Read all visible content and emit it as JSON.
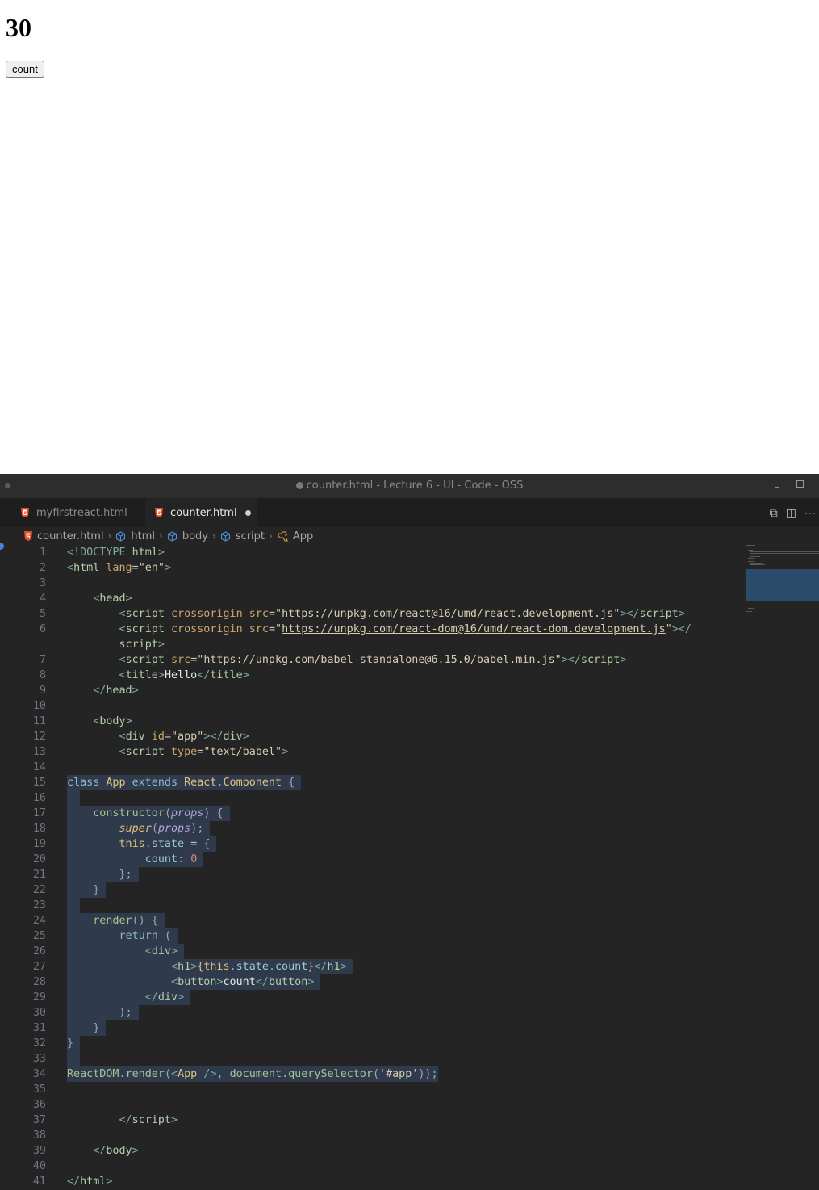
{
  "preview": {
    "heading": "30",
    "button_label": "count"
  },
  "window": {
    "title": "counter.html - Lecture 6 - UI - Code - OSS"
  },
  "tabs": [
    {
      "label": "myfirstreact.html",
      "active": false
    },
    {
      "label": "counter.html",
      "active": true,
      "modified": true
    }
  ],
  "breadcrumb": [
    "counter.html",
    "html",
    "body",
    "script",
    "App"
  ],
  "code": {
    "line_numbers": [
      "1",
      "2",
      "3",
      "4",
      "5",
      "6",
      "",
      "7",
      "8",
      "9",
      "10",
      "11",
      "12",
      "13",
      "14",
      "15",
      "16",
      "17",
      "18",
      "19",
      "20",
      "21",
      "22",
      "23",
      "24",
      "25",
      "26",
      "27",
      "28",
      "29",
      "30",
      "31",
      "32",
      "33",
      "34",
      "35",
      "36",
      "37",
      "38",
      "39",
      "40",
      "41"
    ]
  },
  "colors": {
    "editor_bg": "#242424",
    "selection": "#2f3b4c",
    "accent": "#4c7fd8"
  }
}
